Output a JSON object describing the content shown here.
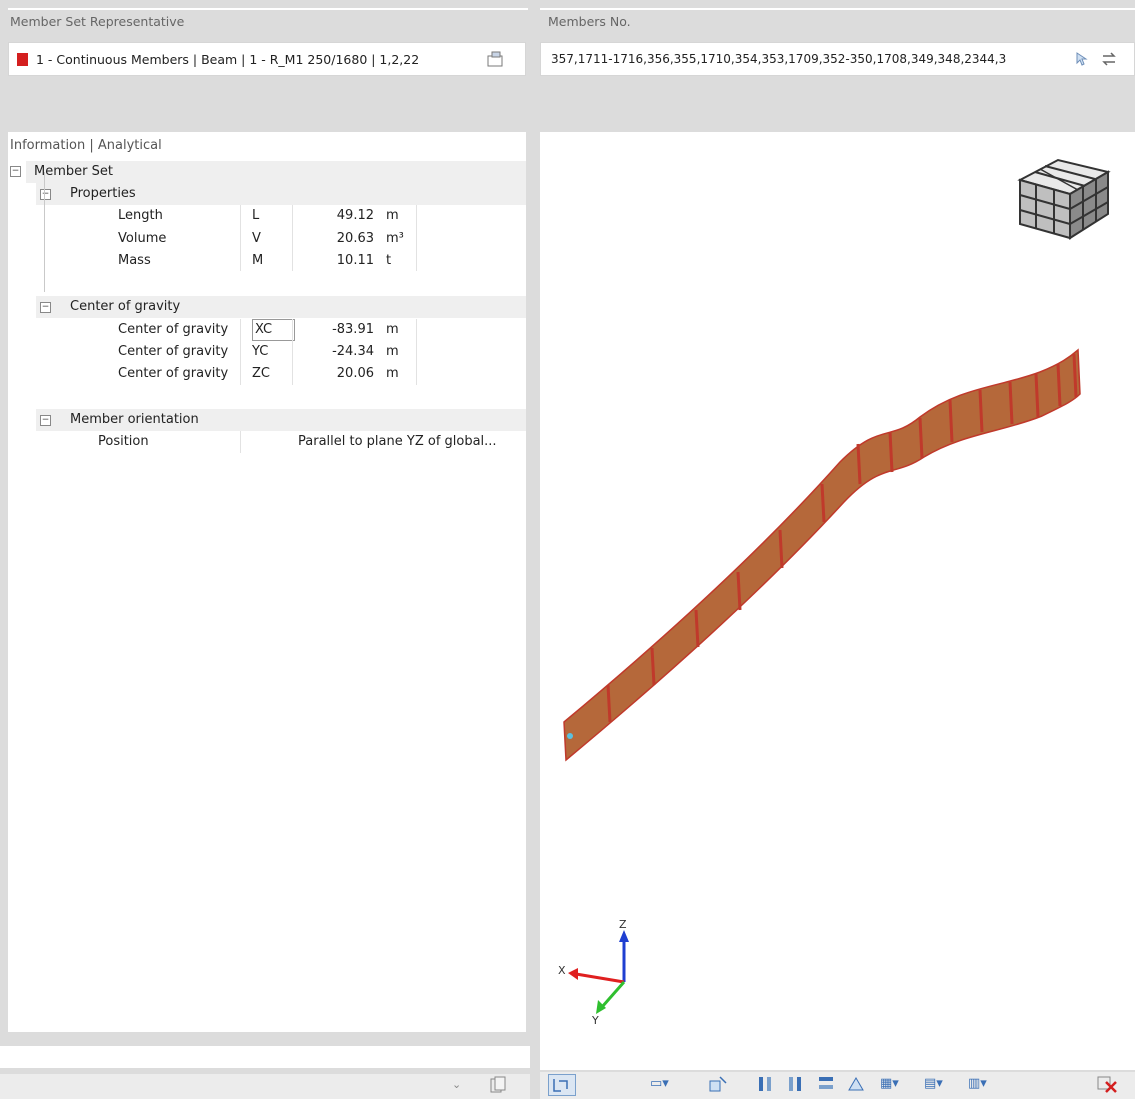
{
  "member_set_rep": {
    "label": "Member Set Representative",
    "value": "1 - Continuous Members | Beam | 1 - R_M1 250/1680 | 1,2,22",
    "color": "#d41f1f"
  },
  "members_no": {
    "label": "Members No.",
    "value": "357,1711-1716,356,355,1710,354,353,1709,352-350,1708,349,348,2344,3"
  },
  "info": {
    "title": "Information | Analytical",
    "root": "Member Set",
    "groups": [
      {
        "name": "Properties",
        "rows": [
          {
            "name": "Length",
            "symbol": "L",
            "value": "49.12",
            "unit": "m"
          },
          {
            "name": "Volume",
            "symbol": "V",
            "value": "20.63",
            "unit": "m³"
          },
          {
            "name": "Mass",
            "symbol": "M",
            "value": "10.11",
            "unit": "t"
          }
        ]
      },
      {
        "name": "Center of gravity",
        "rows": [
          {
            "name": "Center of gravity",
            "symbol": "XC",
            "value": "-83.91",
            "unit": "m"
          },
          {
            "name": "Center of gravity",
            "symbol": "YC",
            "value": "-24.34",
            "unit": "m"
          },
          {
            "name": "Center of gravity",
            "symbol": "ZC",
            "value": "20.06",
            "unit": "m"
          }
        ]
      },
      {
        "name": "Member orientation",
        "rows": [
          {
            "name": "Position",
            "value": "Parallel to plane YZ of global..."
          }
        ]
      }
    ]
  },
  "axes": {
    "x": "X",
    "y": "Y",
    "z": "Z"
  },
  "colors": {
    "beam_fill": "#b5683a",
    "beam_edge": "#c0392b",
    "accent": "#3a6fb5"
  }
}
